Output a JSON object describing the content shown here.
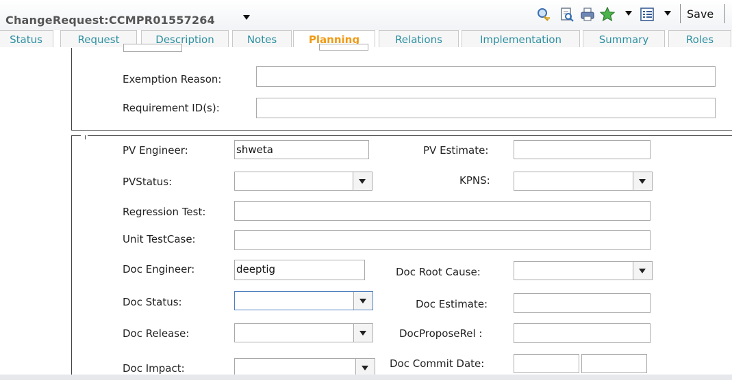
{
  "header": {
    "title": "ChangeRequest:CCMPR01557264",
    "save_label": "Save"
  },
  "toolbar": {
    "icons": [
      "search-key-icon",
      "preview-icon",
      "print-icon",
      "favorite-star-icon",
      "list-view-icon"
    ]
  },
  "tabs": [
    {
      "label": "Status"
    },
    {
      "label": "Request"
    },
    {
      "label": "Description"
    },
    {
      "label": "Notes"
    },
    {
      "label": "Planning",
      "active": true
    },
    {
      "label": "Relations"
    },
    {
      "label": "Implementation"
    },
    {
      "label": "Summary"
    },
    {
      "label": "Roles"
    }
  ],
  "form_top": {
    "exemption_reason": {
      "label": "Exemption Reason:",
      "value": ""
    },
    "requirement_ids": {
      "label": "Requirement ID(s):",
      "value": ""
    }
  },
  "form": {
    "pv_engineer": {
      "label": "PV Engineer:",
      "value": "shweta"
    },
    "pv_estimate": {
      "label": "PV Estimate:",
      "value": ""
    },
    "pv_status": {
      "label": "PVStatus:",
      "value": ""
    },
    "kpns": {
      "label": "KPNS:",
      "value": ""
    },
    "regression_test": {
      "label": "Regression Test:",
      "value": ""
    },
    "unit_testcase": {
      "label": "Unit TestCase:",
      "value": ""
    },
    "doc_engineer": {
      "label": "Doc Engineer:",
      "value": "deeptig"
    },
    "doc_root_cause": {
      "label": "Doc Root Cause:",
      "value": ""
    },
    "doc_status": {
      "label": "Doc Status:",
      "value": ""
    },
    "doc_estimate": {
      "label": "Doc Estimate:",
      "value": ""
    },
    "doc_release": {
      "label": "Doc Release:",
      "value": ""
    },
    "doc_propose_rel": {
      "label": "DocProposeRel :",
      "value": ""
    },
    "doc_impact": {
      "label": "Doc Impact:",
      "value": ""
    },
    "doc_commit_date": {
      "label": "Doc Commit Date:",
      "date": "",
      "time": ""
    }
  }
}
